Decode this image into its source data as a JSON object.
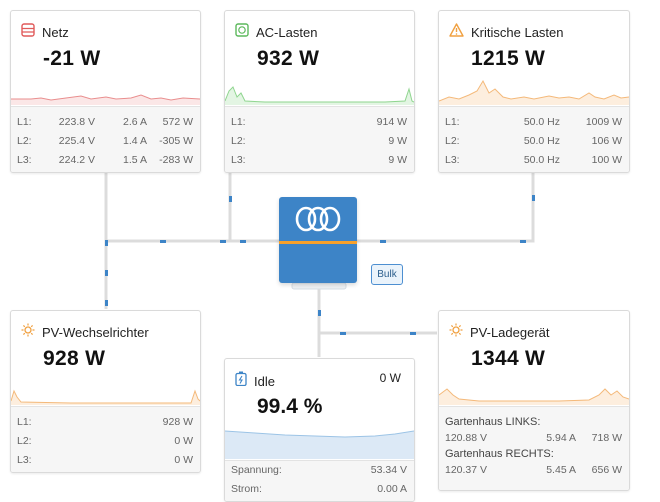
{
  "colors": {
    "wire": "#dcdcdc",
    "wire_dash": "#3d84c7",
    "grid_line": "#e98e8e",
    "ac_line": "#8fd58f",
    "crit_line": "#f4b97a",
    "pv_line": "#f4b97a",
    "battery_line": "#9cc4e6",
    "inverter_blue": "#3d84c7",
    "inverter_orange": "#f7a02a"
  },
  "netz": {
    "icon": "grid-icon",
    "title": "Netz",
    "value": "-21 W",
    "phases": [
      {
        "label": "L1:",
        "voltage": "223.8 V",
        "current": "2.6 A",
        "power": "572 W"
      },
      {
        "label": "L2:",
        "voltage": "225.4 V",
        "current": "1.4 A",
        "power": "-305 W"
      },
      {
        "label": "L3:",
        "voltage": "224.2 V",
        "current": "1.5 A",
        "power": "-283 W"
      }
    ]
  },
  "ac_lasten": {
    "icon": "plug-icon",
    "title": "AC-Lasten",
    "value": "932 W",
    "phases": [
      {
        "label": "L1:",
        "power": "914 W"
      },
      {
        "label": "L2:",
        "power": "9 W"
      },
      {
        "label": "L3:",
        "power": "9 W"
      }
    ]
  },
  "kritische_lasten": {
    "icon": "warning-icon",
    "title": "Kritische Lasten",
    "value": "1215 W",
    "phases": [
      {
        "label": "L1:",
        "frequency": "50.0 Hz",
        "power": "1009 W"
      },
      {
        "label": "L2:",
        "frequency": "50.0 Hz",
        "power": "106 W"
      },
      {
        "label": "L3:",
        "frequency": "50.0 Hz",
        "power": "100 W"
      }
    ]
  },
  "inverter": {
    "logo": "victron-logo",
    "state": "Bulk"
  },
  "pv_wechselrichter": {
    "icon": "sun-icon",
    "title": "PV-Wechselrichter",
    "value": "928 W",
    "phases": [
      {
        "label": "L1:",
        "power": "928 W"
      },
      {
        "label": "L2:",
        "power": "0 W"
      },
      {
        "label": "L3:",
        "power": "0 W"
      }
    ]
  },
  "battery": {
    "icon": "battery-icon",
    "title": "Idle",
    "power": "0 W",
    "soc": "99.4 %",
    "soc_fraction": 0.994,
    "rows": [
      {
        "label": "Spannung:",
        "value": "53.34 V"
      },
      {
        "label": "Strom:",
        "value": "0.00 A"
      }
    ]
  },
  "pv_ladegeraet": {
    "icon": "sun-icon",
    "title": "PV-Ladegerät",
    "value": "1344 W",
    "chargers": [
      {
        "name": "Gartenhaus LINKS:",
        "voltage": "120.88 V",
        "current": "5.94 A",
        "power": "718 W"
      },
      {
        "name": "Gartenhaus RECHTS:",
        "voltage": "120.37 V",
        "current": "5.45 A",
        "power": "656 W"
      }
    ]
  }
}
